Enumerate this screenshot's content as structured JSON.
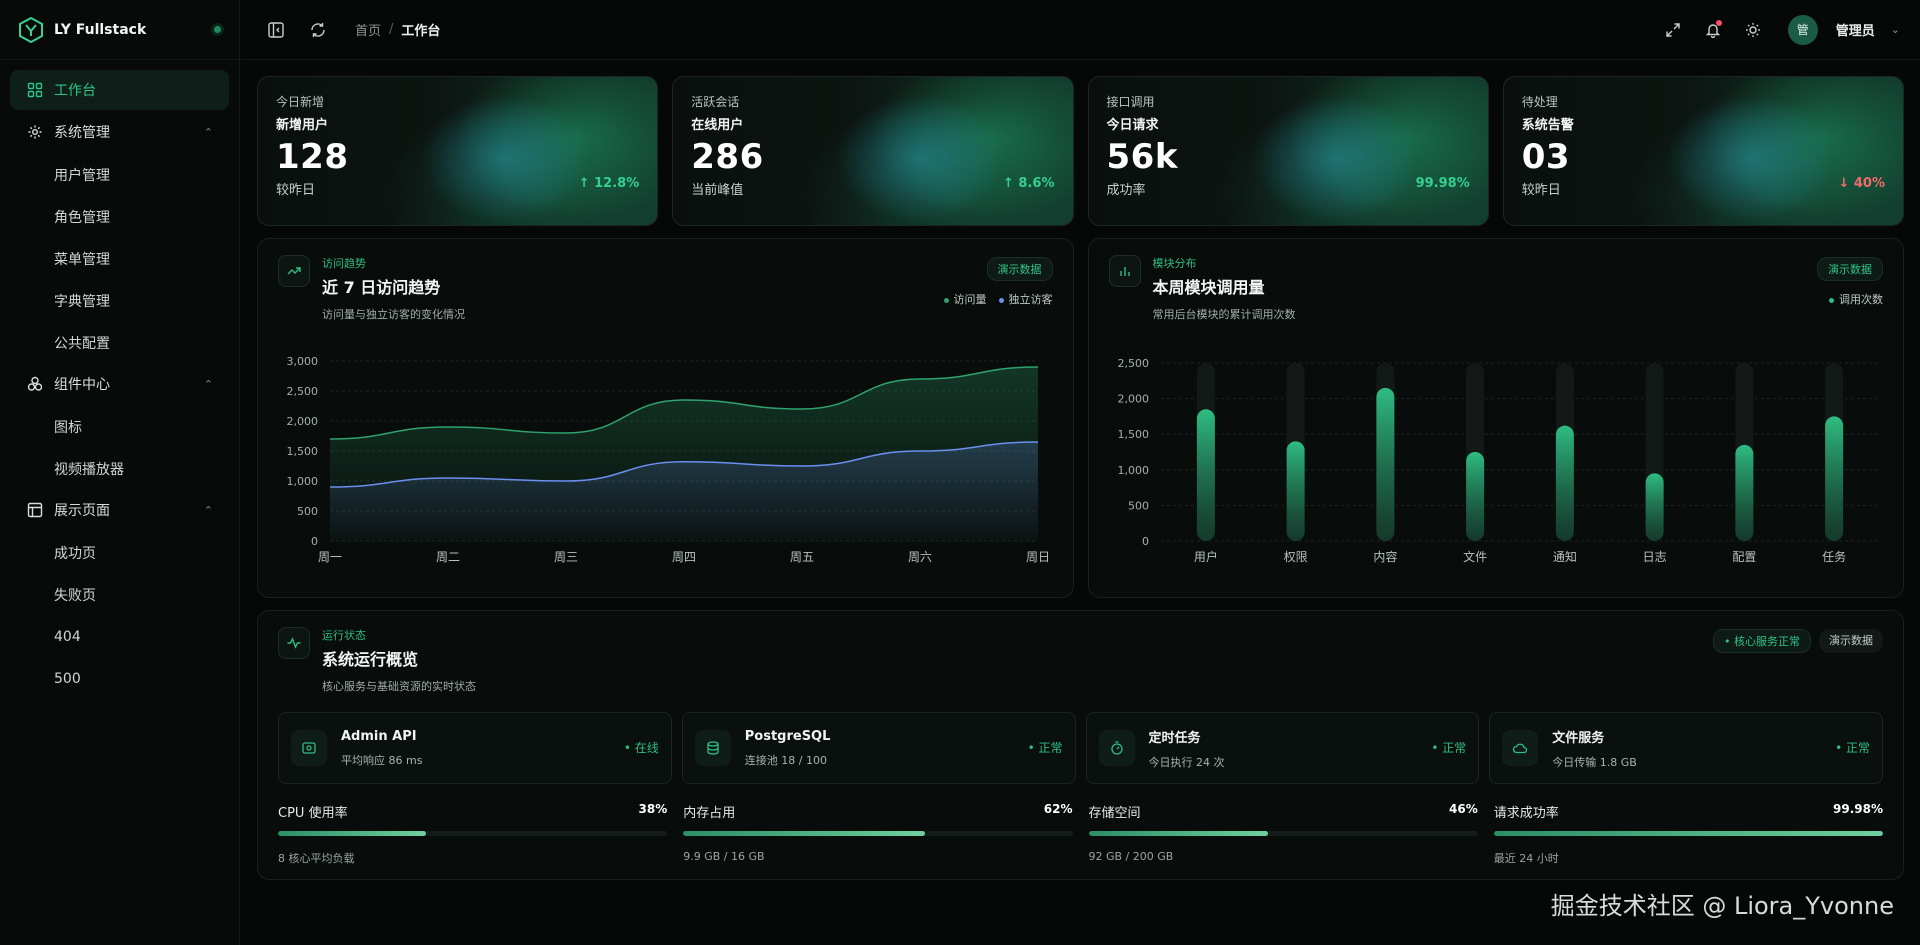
{
  "brand": {
    "name": "LY Fullstack",
    "logo": "ly-hexagon-logo"
  },
  "sidebar": {
    "items": [
      {
        "label": "工作台",
        "icon": "grid-icon",
        "active": true
      },
      {
        "label": "系统管理",
        "icon": "gear-icon",
        "children": [
          "用户管理",
          "角色管理",
          "菜单管理",
          "字典管理",
          "公共配置"
        ]
      },
      {
        "label": "组件中心",
        "icon": "components-icon",
        "children": [
          "图标",
          "视频播放器"
        ]
      },
      {
        "label": "展示页面",
        "icon": "layout-icon",
        "children": [
          "成功页",
          "失败页",
          "404",
          "500"
        ]
      }
    ]
  },
  "header": {
    "breadcrumb": {
      "home": "首页",
      "separator": "/",
      "current": "工作台"
    },
    "user": {
      "avatar_text": "管",
      "name": "管理员"
    }
  },
  "stats": [
    {
      "category": "今日新增",
      "title": "新增用户",
      "value": "128",
      "sub": "较昨日",
      "trend": "↑ 12.8%",
      "direction": "up"
    },
    {
      "category": "活跃会话",
      "title": "在线用户",
      "value": "286",
      "sub": "当前峰值",
      "trend": "↑ 8.6%",
      "direction": "up"
    },
    {
      "category": "接口调用",
      "title": "今日请求",
      "value": "56k",
      "sub": "成功率",
      "trend": "99.98%",
      "direction": "up"
    },
    {
      "category": "待处理",
      "title": "系统告警",
      "value": "03",
      "sub": "较昨日",
      "trend": "↓ 40%",
      "direction": "down"
    }
  ],
  "visits_panel": {
    "category": "访问趋势",
    "title": "近 7 日访问趋势",
    "desc": "访问量与独立访客的变化情况",
    "badge": "演示数据",
    "legend": [
      "访问量",
      "独立访客"
    ]
  },
  "modules_panel": {
    "category": "模块分布",
    "title": "本周模块调用量",
    "desc": "常用后台模块的累计调用次数",
    "badge": "演示数据",
    "legend": [
      "调用次数"
    ]
  },
  "chart_data": [
    {
      "type": "area",
      "categories": [
        "周一",
        "周二",
        "周三",
        "周四",
        "周五",
        "周六",
        "周日"
      ],
      "series": [
        {
          "name": "访问量",
          "values": [
            1700,
            1900,
            1800,
            2350,
            2200,
            2700,
            2900
          ],
          "color": "#2fa36f"
        },
        {
          "name": "独立访客",
          "values": [
            900,
            1050,
            1000,
            1320,
            1250,
            1500,
            1650
          ],
          "color": "#6c8ff0"
        }
      ],
      "yticks": [
        "3,000",
        "2,500",
        "2,000",
        "1,500",
        "1,000",
        "500",
        "0"
      ],
      "ylim": [
        0,
        3000
      ],
      "grid": true
    },
    {
      "type": "bar",
      "categories": [
        "用户",
        "权限",
        "内容",
        "文件",
        "通知",
        "日志",
        "配置",
        "任务"
      ],
      "series": [
        {
          "name": "调用次数",
          "values": [
            1850,
            1400,
            2150,
            1250,
            1620,
            950,
            1350,
            1750
          ],
          "color": "#2fbd83"
        }
      ],
      "yticks": [
        "2,500",
        "2,000",
        "1,500",
        "1,000",
        "500",
        "0"
      ],
      "ylim": [
        0,
        2500
      ],
      "grid": true
    }
  ],
  "status_panel": {
    "category": "运行状态",
    "title": "系统运行概览",
    "desc": "核心服务与基础资源的实时状态",
    "badge_ok": "• 核心服务正常",
    "badge": "演示数据"
  },
  "services": [
    {
      "name": "Admin API",
      "detail": "平均响应 86 ms",
      "status": "• 在线",
      "icon": "server-icon"
    },
    {
      "name": "PostgreSQL",
      "detail": "连接池 18 / 100",
      "status": "• 正常",
      "icon": "database-icon"
    },
    {
      "name": "定时任务",
      "detail": "今日执行 24 次",
      "status": "• 正常",
      "icon": "timer-icon"
    },
    {
      "name": "文件服务",
      "detail": "今日传输 1.8 GB",
      "status": "• 正常",
      "icon": "cloud-icon"
    }
  ],
  "metrics": [
    {
      "label": "CPU 使用率",
      "value": "38%",
      "fill": 0.38,
      "sub": "8 核心平均负载"
    },
    {
      "label": "内存占用",
      "value": "62%",
      "fill": 0.62,
      "sub": "9.9 GB / 16 GB"
    },
    {
      "label": "存储空间",
      "value": "46%",
      "fill": 0.46,
      "sub": "92 GB / 200 GB"
    },
    {
      "label": "请求成功率",
      "value": "99.98%",
      "fill": 0.9998,
      "sub": "最近 24 小时"
    }
  ],
  "watermark": "掘金技术社区 @ Liora_Yvonne"
}
